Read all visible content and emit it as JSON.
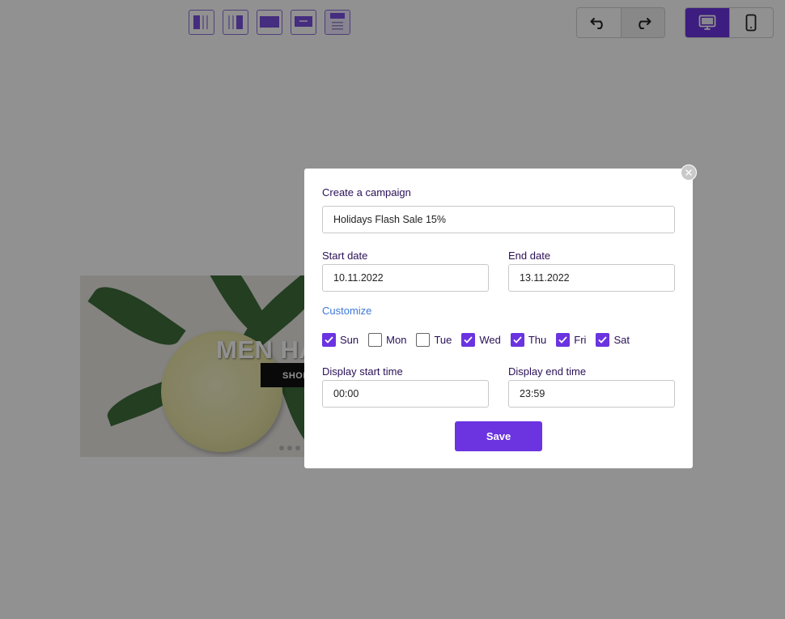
{
  "editor": {
    "layout_options": [
      "layout-two-column-left",
      "layout-two-column-right",
      "layout-full-banner",
      "layout-centered-banner",
      "layout-stacked"
    ],
    "history": {
      "undo_icon": "undo-icon",
      "redo_icon": "redo-icon"
    },
    "device": {
      "desktop_icon": "desktop-icon",
      "mobile_icon": "mobile-icon",
      "active": "desktop"
    },
    "banner": {
      "title": "MEN HA",
      "cta_label": "SHOP"
    }
  },
  "modal": {
    "close_icon": "close-icon",
    "campaign_label": "Create a campaign",
    "campaign_name": "Holidays Flash Sale 15%",
    "start_date_label": "Start date",
    "start_date": "10.11.2022",
    "end_date_label": "End date",
    "end_date": "13.11.2022",
    "customize_label": "Customize",
    "days": [
      {
        "label": "Sun",
        "checked": true
      },
      {
        "label": "Mon",
        "checked": false
      },
      {
        "label": "Tue",
        "checked": false
      },
      {
        "label": "Wed",
        "checked": true
      },
      {
        "label": "Thu",
        "checked": true
      },
      {
        "label": "Fri",
        "checked": true
      },
      {
        "label": "Sat",
        "checked": true
      }
    ],
    "start_time_label": "Display start time",
    "start_time": "00:00",
    "end_time_label": "Display end time",
    "end_time": "23:59",
    "save_label": "Save"
  },
  "colors": {
    "accent": "#6b34e0",
    "link": "#3d78d8",
    "label": "#2a1057",
    "overlay": "rgba(0,0,0,0.43)"
  }
}
